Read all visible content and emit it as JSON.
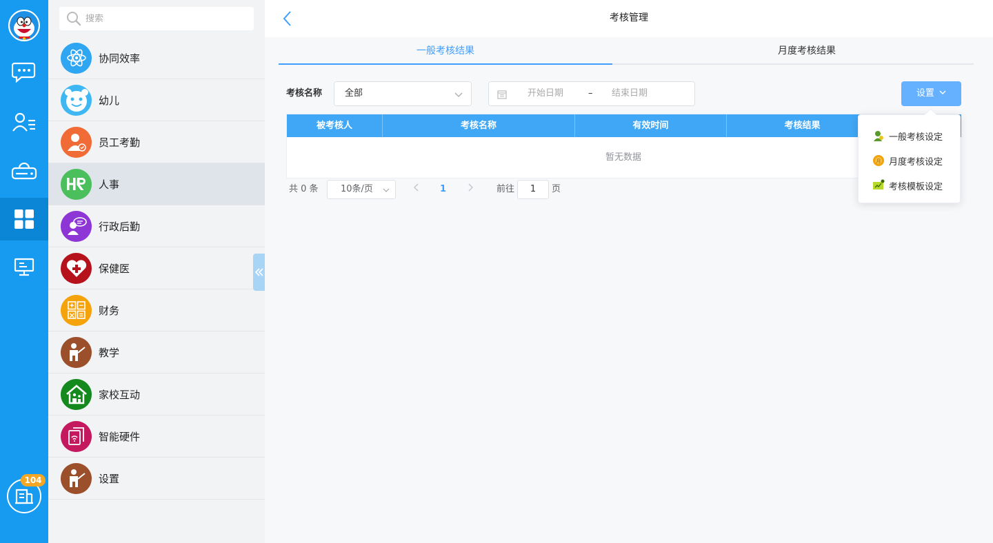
{
  "rail": {
    "icons": [
      "avatar",
      "chat-icon",
      "contacts-icon",
      "cloud-drive-icon",
      "apps-grid-icon",
      "monitor-icon"
    ],
    "badge_count": "104",
    "accent": "#169bf0"
  },
  "sidebar": {
    "search_placeholder": "搜索",
    "items": [
      {
        "label": "协同效率",
        "icon": "atom-icon",
        "color": "#2ea6f2"
      },
      {
        "label": "幼儿",
        "icon": "child-face-icon",
        "color": "#3fb7f2"
      },
      {
        "label": "员工考勤",
        "icon": "staff-attendance-icon",
        "color": "#f06b35"
      },
      {
        "label": "人事",
        "icon": "hr-icon",
        "color": "#4cbf5d"
      },
      {
        "label": "行政后勤",
        "icon": "admin-icon",
        "color": "#8e35d6"
      },
      {
        "label": "保健医",
        "icon": "health-heart-icon",
        "color": "#b5121b"
      },
      {
        "label": "财务",
        "icon": "finance-calculator-icon",
        "color": "#f5a30a"
      },
      {
        "label": "教学",
        "icon": "teaching-icon",
        "color": "#9b4f2a"
      },
      {
        "label": "家校互动",
        "icon": "home-school-icon",
        "color": "#148a1e"
      },
      {
        "label": "智能硬件",
        "icon": "smart-hardware-icon",
        "color": "#c5195f"
      },
      {
        "label": "设置",
        "icon": "settings-person-icon",
        "color": "#9b4f2a"
      }
    ],
    "active_index": 3
  },
  "header": {
    "title": "考核管理"
  },
  "tabs": [
    {
      "label": "一般考核结果",
      "active": true
    },
    {
      "label": "月度考核结果",
      "active": false
    }
  ],
  "filter": {
    "name_label": "考核名称",
    "select_value": "全部",
    "start_placeholder": "开始日期",
    "separator": "–",
    "end_placeholder": "结束日期",
    "settings_label": "设置"
  },
  "table": {
    "columns": [
      "被考核人",
      "考核名称",
      "有效时间",
      "考核结果",
      ""
    ],
    "empty_text": "暂无数据"
  },
  "pagination": {
    "total": "共 0 条",
    "page_size": "10条/页",
    "current_page": "1",
    "goto_label": "前往",
    "goto_value": "1",
    "page_unit": "页"
  },
  "dropdown": {
    "items": [
      {
        "label": "一般考核设定",
        "icon": "general-review-icon"
      },
      {
        "label": "月度考核设定",
        "icon": "monthly-review-icon"
      },
      {
        "label": "考核模板设定",
        "icon": "template-review-icon"
      }
    ]
  }
}
